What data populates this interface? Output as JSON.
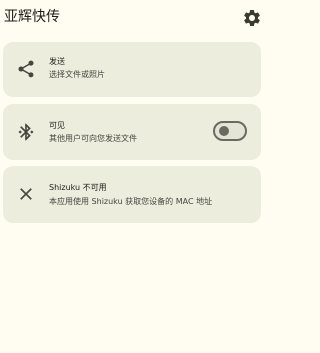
{
  "app_bar": {
    "title": "亚辉快传",
    "settings_icon": "gear-icon"
  },
  "cards": {
    "send": {
      "icon": "share-icon",
      "title": "发送",
      "subtitle": "选择文件或照片"
    },
    "visibility": {
      "icon": "bluetooth-icon",
      "title": "可见",
      "subtitle": "其他用户可向您发送文件",
      "toggle_on": false
    },
    "shizuku": {
      "icon": "close-icon",
      "title": "Shizuku 不可用",
      "subtitle": "本应用使用 Shizuku 获取您设备的 MAC 地址"
    }
  },
  "colors": {
    "background": "#fffdf1",
    "card": "#ededde",
    "icon": "#45463e",
    "toggle_outline": "#6a6b60"
  }
}
